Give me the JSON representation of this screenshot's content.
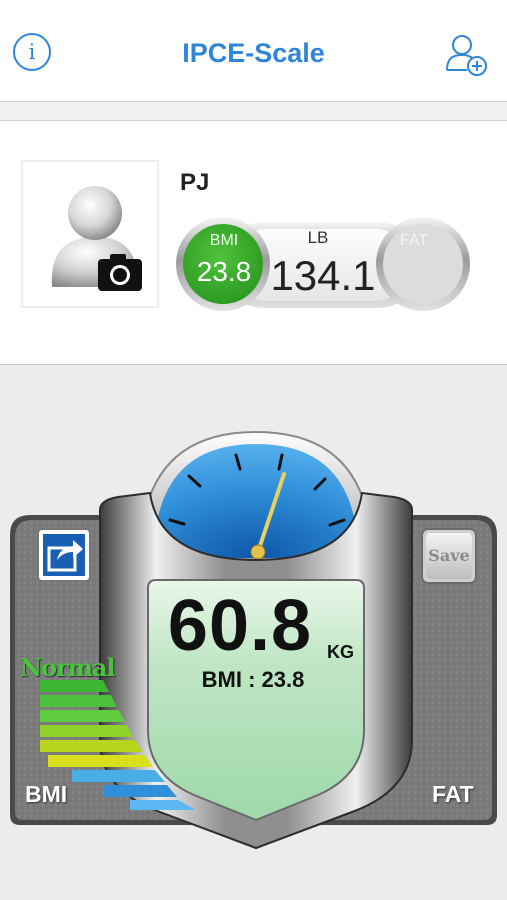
{
  "header": {
    "info_glyph": "i",
    "title": "IPCE-Scale",
    "info_icon": "info-icon",
    "add_user_icon": "add-user-icon"
  },
  "profile": {
    "name": "PJ",
    "avatar_icon": "user-avatar-icon",
    "camera_icon": "camera-icon",
    "bmi_label": "BMI",
    "bmi_value": "23.8",
    "lb_label": "LB",
    "lb_value": "134.1",
    "fat_label": "FAT",
    "bmi_color": "#3aae2a"
  },
  "scale": {
    "weight": "60.8",
    "unit": "KG",
    "bmi_readout": "BMI : 23.8",
    "status_label": "Normal",
    "share_icon": "share-icon",
    "save_label": "Save",
    "left_corner_label": "BMI",
    "right_corner_label": "FAT",
    "dial_color": "#2f8fd8",
    "display_color": "#a8dcb0"
  }
}
